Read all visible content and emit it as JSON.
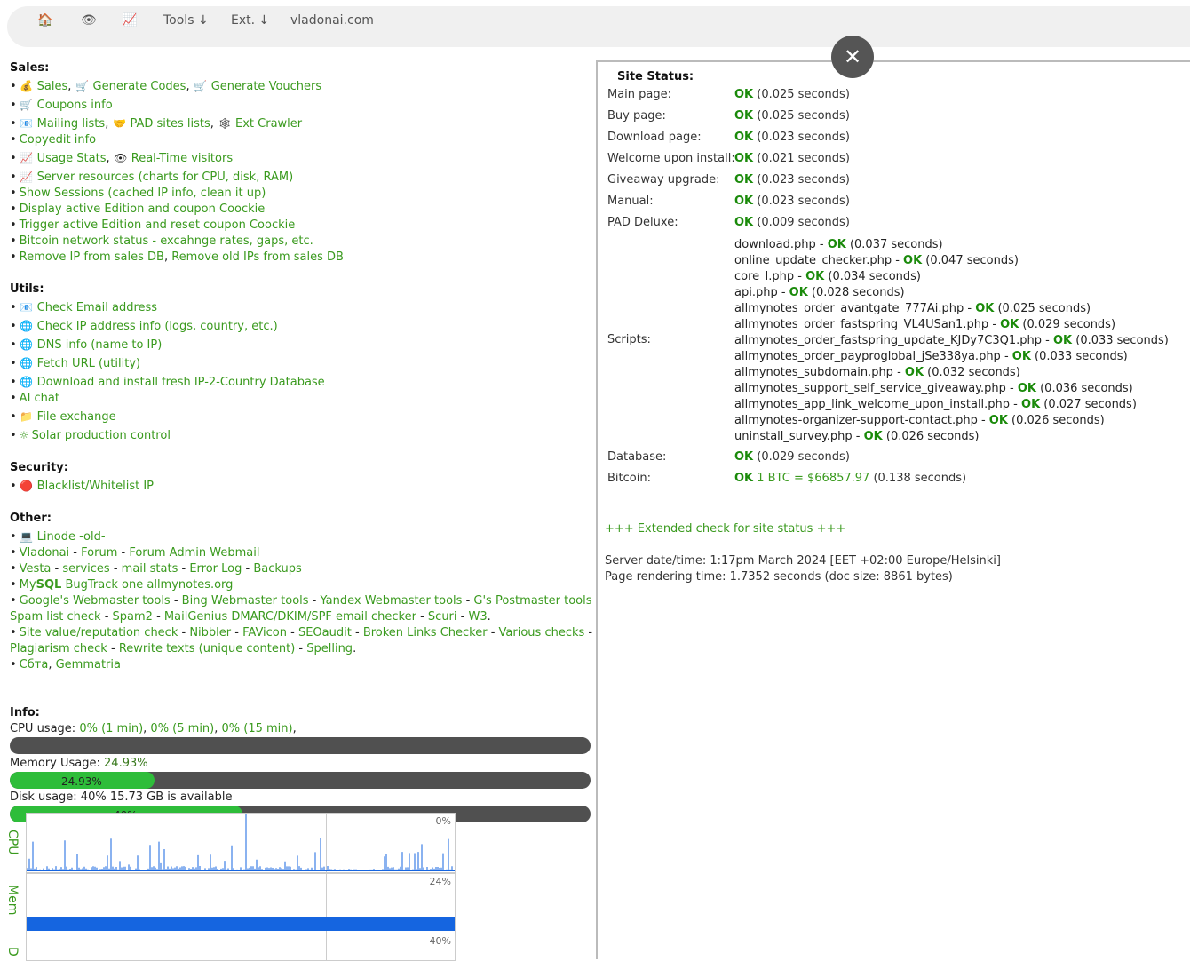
{
  "nav": {
    "home": "🏠",
    "view": "👁",
    "stats": "📈",
    "tools": "Tools ↓",
    "ext": "Ext. ↓",
    "site": "vladonai.com"
  },
  "close_label": "✕",
  "sales": {
    "title": "Sales:",
    "r1": {
      "a": "Sales",
      "b": "Generate Codes",
      "c": "Generate Vouchers"
    },
    "r2": "Coupons info",
    "r3": {
      "a": "Mailing lists",
      "b": "PAD sites lists",
      "c": "Ext Crawler"
    },
    "r4": "Copyedit info",
    "r5": {
      "a": "Usage Stats",
      "b": "Real-Time visitors"
    },
    "r6": "Server resources (charts for CPU, disk, RAM)",
    "r7": "Show Sessions (cached IP info, clean it up)",
    "r8": "Display active Edition and coupon Coockie",
    "r9": "Trigger active Edition and reset coupon Coockie",
    "r10": "Bitcoin network status - excahnge rates, gaps, etc.",
    "r11": {
      "a": "Remove IP from sales DB",
      "b": "Remove old IPs from sales DB"
    }
  },
  "utils": {
    "title": "Utils:",
    "items": [
      "Check Email address",
      "Check IP address info (logs, country, etc.)",
      "DNS info (name to IP)",
      "Fetch URL (utility)",
      "Download and install fresh IP-2-Country Database",
      "AI chat",
      "File exchange",
      "Solar production control"
    ]
  },
  "security": {
    "title": "Security:",
    "item": "Blacklist/Whitelist IP"
  },
  "other": {
    "title": "Other:",
    "linode": "Linode -old-",
    "vl": {
      "a": "Vladonai",
      "b": "Forum",
      "c": "Forum Admin",
      "d": "Webmail"
    },
    "vesta": {
      "a": "Vesta",
      "b": "services",
      "c": "mail stats",
      "d": "Error Log",
      "e": "Backups"
    },
    "mysql": {
      "a": "My",
      "b": "SQL",
      "c": "BugTrack",
      "d": "one",
      "e": "allmynotes.org"
    },
    "wm": {
      "a": "Google's Webmaster tools",
      "b": "Bing Webmaster tools",
      "c": "Yandex Webmaster tools",
      "d": "G's Postmaster tools"
    },
    "spam": {
      "a": "Spam list check",
      "b": "Spam2",
      "c": "MailGenius",
      "d": "DMARC/DKIM/SPF email checker",
      "e": "Scuri",
      "f": "W3"
    },
    "site": {
      "a": "Site value/reputation check",
      "b": "Nibbler",
      "c": "FAVicon",
      "d": "SEOaudit",
      "e": "Broken Links Checker",
      "f": "Various checks"
    },
    "plag": {
      "a": "Plagiarism check",
      "b": "Rewrite texts (unique content)",
      "c": "Spelling"
    },
    "last": {
      "a": "Сбта",
      "b": "Gemmatria"
    }
  },
  "info": {
    "title": "Info:",
    "cpu_label": "CPU usage:",
    "cpu_1": "0% (1 min)",
    "cpu_5": "0% (5 min)",
    "cpu_15": "0% (15 min)",
    "mem_label": "Memory Usage:",
    "mem_val": "24.93%",
    "mem_fraction": 0.2493,
    "disk_label": "Disk usage: 40% 15.73 GB is available",
    "disk_val": "40%",
    "disk_fraction": 0.4
  },
  "charts": {
    "cpu_label": "CPU",
    "mem_label": "Mem",
    "disk_label": "D",
    "cpu_pct": "0%",
    "mem_pct": "24%",
    "disk_pct": "40%"
  },
  "status": {
    "title": "Site Status:",
    "rows": [
      {
        "label": "Main page:",
        "ok": "OK",
        "time": "(0.025 seconds)"
      },
      {
        "label": "Buy page:",
        "ok": "OK",
        "time": "(0.025 seconds)"
      },
      {
        "label": "Download page:",
        "ok": "OK",
        "time": "(0.023 seconds)"
      },
      {
        "label": "Welcome upon install:",
        "ok": "OK",
        "time": "(0.021 seconds)"
      },
      {
        "label": "Giveaway upgrade:",
        "ok": "OK",
        "time": "(0.023 seconds)"
      },
      {
        "label": "Manual:",
        "ok": "OK",
        "time": "(0.023 seconds)"
      },
      {
        "label": "PAD Deluxe:",
        "ok": "OK",
        "time": "(0.009 seconds)"
      }
    ],
    "scripts_label": "Scripts:",
    "scripts": [
      {
        "name": "download.php - ",
        "ok": "OK",
        "time": " (0.037 seconds)"
      },
      {
        "name": "online_update_checker.php - ",
        "ok": "OK",
        "time": " (0.047 seconds)"
      },
      {
        "name": "core_l.php - ",
        "ok": "OK",
        "time": " (0.034 seconds)"
      },
      {
        "name": "api.php - ",
        "ok": "OK",
        "time": " (0.028 seconds)"
      },
      {
        "name": "allmynotes_order_avantgate_777Ai.php - ",
        "ok": "OK",
        "time": " (0.025 seconds)"
      },
      {
        "name": "allmynotes_order_fastspring_VL4USan1.php - ",
        "ok": "OK",
        "time": " (0.029 seconds)"
      },
      {
        "name": "allmynotes_order_fastspring_update_KJDy7C3Q1.php - ",
        "ok": "OK",
        "time": " (0.033 seconds)"
      },
      {
        "name": "allmynotes_order_payproglobal_jSe338ya.php - ",
        "ok": "OK",
        "time": " (0.033 seconds)"
      },
      {
        "name": "allmynotes_subdomain.php - ",
        "ok": "OK",
        "time": " (0.032 seconds)"
      },
      {
        "name": "allmynotes_support_self_service_giveaway.php - ",
        "ok": "OK",
        "time": " (0.036 seconds)"
      },
      {
        "name": "allmynotes_app_link_welcome_upon_install.php - ",
        "ok": "OK",
        "time": " (0.027 seconds)"
      },
      {
        "name": "allmynotes-organizer-support-contact.php - ",
        "ok": "OK",
        "time": " (0.026 seconds)"
      },
      {
        "name": "uninstall_survey.php - ",
        "ok": "OK",
        "time": " (0.026 seconds)"
      }
    ],
    "db_label": "Database:",
    "db_ok": "OK",
    "db_time": "(0.029 seconds)",
    "btc_label": "Bitcoin:",
    "btc_ok": "OK",
    "btc_rate": "1 BTC = $66857.97",
    "btc_time": "(0.138 seconds)",
    "extended": "+++ Extended check for site status +++",
    "server_time": "Server date/time: 1:17pm March 2024 [EET +02:00 Europe/Helsinki]",
    "render_time": "Page rendering time: 1.7352 seconds (doc size: 8861 bytes)"
  }
}
